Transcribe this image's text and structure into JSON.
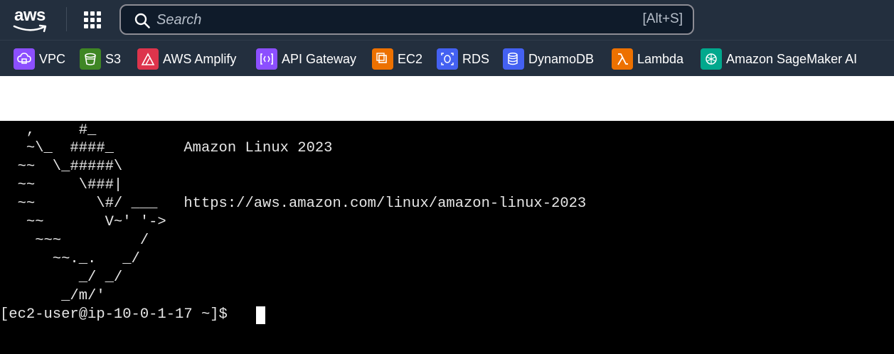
{
  "header": {
    "logo_text": "aws",
    "search_placeholder": "Search",
    "search_shortcut": "[Alt+S]",
    "grid_icon": "services-grid-icon"
  },
  "favorites": [
    {
      "label": "VPC",
      "icon": "vpc-icon",
      "color": "#8c4fff"
    },
    {
      "label": "S3",
      "icon": "s3-bucket-icon",
      "color": "#3f8624"
    },
    {
      "label": "AWS Amplify",
      "icon": "amplify-icon",
      "color": "#dd344c"
    },
    {
      "label": "API Gateway",
      "icon": "api-gateway-icon",
      "color": "#8c4fff"
    },
    {
      "label": "EC2",
      "icon": "ec2-chip-icon",
      "color": "#ed7100"
    },
    {
      "label": "RDS",
      "icon": "rds-icon",
      "color": "#4461f2"
    },
    {
      "label": "DynamoDB",
      "icon": "dynamodb-icon",
      "color": "#4461f2"
    },
    {
      "label": "Lambda",
      "icon": "lambda-icon",
      "color": "#ed7100"
    },
    {
      "label": "Amazon SageMaker AI",
      "icon": "sagemaker-icon",
      "color": "#01a88d"
    }
  ],
  "terminal": {
    "lines": [
      "   ,     #_",
      "   ~\\_  ####_        Amazon Linux 2023",
      "  ~~  \\_#####\\",
      "  ~~     \\###|",
      "  ~~       \\#/ ___   https://aws.amazon.com/linux/amazon-linux-2023",
      "   ~~       V~' '->",
      "    ~~~         /",
      "      ~~._.   _/",
      "         _/ _/",
      "       _/m/'"
    ],
    "prompt": "[ec2-user@ip-10-0-1-17 ~]$ "
  }
}
